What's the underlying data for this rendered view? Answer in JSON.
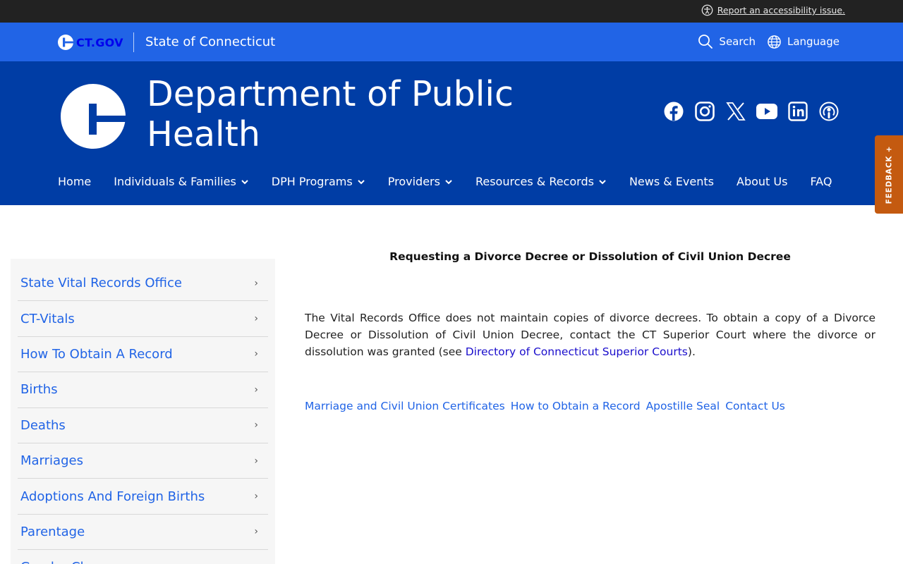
{
  "util_bar": {
    "accessibility_link": "Report an accessibility issue."
  },
  "state_bar": {
    "logo_text": "CT.GOV",
    "state_name": "State of Connecticut",
    "search_label": "Search",
    "language_label": "Language"
  },
  "agency": {
    "title": "Department of Public Health",
    "social": [
      "facebook-icon",
      "instagram-icon",
      "x-icon",
      "youtube-icon",
      "linkedin-icon",
      "podcast-icon"
    ]
  },
  "nav": [
    {
      "label": "Home",
      "dropdown": false
    },
    {
      "label": "Individuals & Families",
      "dropdown": true
    },
    {
      "label": "DPH Programs",
      "dropdown": true
    },
    {
      "label": "Providers",
      "dropdown": true
    },
    {
      "label": "Resources & Records",
      "dropdown": true
    },
    {
      "label": "News & Events",
      "dropdown": false
    },
    {
      "label": "About Us",
      "dropdown": false
    },
    {
      "label": "FAQ",
      "dropdown": false
    }
  ],
  "feedback_label": "FEEDBACK +",
  "sidebar": {
    "items": [
      "State Vital Records Office",
      "CT-Vitals",
      "How To Obtain A Record",
      "Births",
      "Deaths",
      "Marriages",
      "Adoptions And Foreign Births",
      "Parentage",
      "Gender Change"
    ]
  },
  "content": {
    "heading": "Requesting a Divorce Decree or Dissolution of Civil Union Decree",
    "paragraph_before": "The Vital Records Office does not maintain copies of divorce decrees. To obtain a copy of a Divorce Decree or Dissolution of Civil Union Decree, contact the CT Superior Court where the divorce or dissolution was granted (see ",
    "paragraph_link": "Directory of Connecticut Superior Courts",
    "paragraph_after": ").",
    "related_links": [
      "Marriage and Civil Union Certificates",
      "How to Obtain a Record",
      "Apostille Seal",
      "Contact Us"
    ]
  },
  "colors": {
    "util_bar": "#222222",
    "state_bar": "#2164e6",
    "agency_header": "#003da5",
    "link": "#2164e6",
    "feedback": "#c45a10"
  }
}
